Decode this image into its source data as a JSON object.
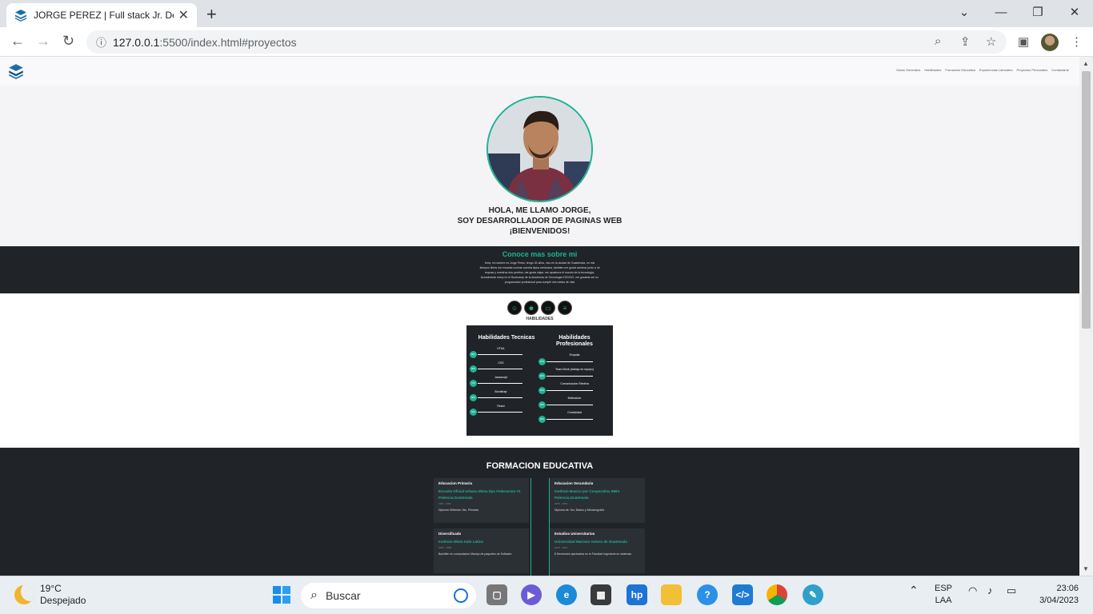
{
  "browser": {
    "tab_title": "JORGE PEREZ | Full stack Jr. Devel",
    "url_host": "127.0.0.1",
    "url_rest": ":5500/index.html#proyectos"
  },
  "site": {
    "nav": [
      "Datos Generales",
      "Habilidades",
      "Formacion Educativa",
      "Experiencias Laborales",
      "Proyectos Personales",
      "Contactame"
    ],
    "hero_line1": "HOLA, ME LLAMO JORGE,",
    "hero_line2": "SOY DESARROLLADOR DE PAGINAS WEB",
    "hero_line3": "¡BIENVENIDOS!",
    "about_title": "Conoce mas sobre mi",
    "about_text": "Hola, mi nombre es Jorge Perez, tengo 32 años, vivo en la ciudad de Guatemala, en mis tiempos libres me encanta cocinar comida tipica mexicana, tambien me gusta caminar junto a mi esposa y nuestros dos perritos, me gusta viajar, me apasiona el mundo de la tecnologia, Actualmente estoy en el Bootcamp de la Academia de Tecnologia KODIGO, me gustaria ser un programador profesional para cumplir mis metas de vida",
    "habilidades_label": "HABILIDADES",
    "tech_title": "Habilidades Tecnicas",
    "prof_title": "Habilidades Profesionales",
    "tech_skills": [
      {
        "name": "HTML",
        "pct": "80%"
      },
      {
        "name": "CSS",
        "pct": "80%"
      },
      {
        "name": "Javascript",
        "pct": "70%"
      },
      {
        "name": "Bootstrap",
        "pct": "80%"
      },
      {
        "name": "React",
        "pct": "50%"
      }
    ],
    "prof_skills": [
      {
        "name": "Empatia",
        "pct": "90%"
      },
      {
        "name": "Team Work (trabajo en equipo)",
        "pct": "90%"
      },
      {
        "name": "Comunicacion Efectiva",
        "pct": "80%"
      },
      {
        "name": "Motivacion",
        "pct": "90%"
      },
      {
        "name": "Creatividad",
        "pct": "90%"
      }
    ],
    "edu_title": "FORMACION EDUCATIVA",
    "edu": [
      {
        "level": "Educacion Primaria",
        "school": "Escuela Oficial Urbana Mixta tipo Federacion #1 Palencia,Guatemala",
        "years": "1997 - 2002",
        "diploma": "Diploma Obtenido: 6to. Primaria"
      },
      {
        "level": "Educacion Secundaria",
        "school": "Instituto Basico por Cooperativa INBA Palencia,Guatemala",
        "years": "2003 - 2005",
        "diploma": "Diploma de: 3ro. Basico y Mecanografia"
      },
      {
        "level": "Diversificado",
        "school": "Instituto Mixto Indo Latino",
        "years": "2006 - 2008",
        "diploma": "Bachiller en computacion Manejo de paquetes de Software"
      },
      {
        "level": "Estudios Universitarios",
        "school": "Universidad Mariano Galvez de Guatemala",
        "years": "2010 - 2016",
        "diploma": "8 Semestres aprobados en la Facultad Ingenieria en sistemas"
      }
    ]
  },
  "taskbar": {
    "temp": "19°C",
    "condition": "Despejado",
    "search": "Buscar",
    "lang1": "ESP",
    "lang2": "LAA",
    "time": "23:06",
    "date": "3/04/2023"
  }
}
